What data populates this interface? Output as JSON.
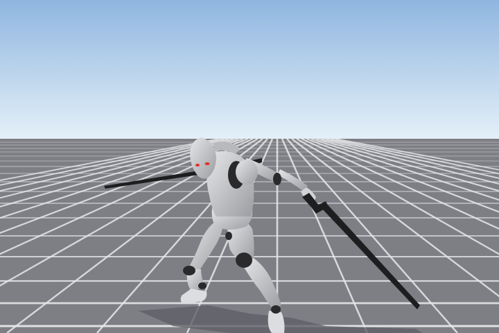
{
  "scene": {
    "sky_top_color": "#8fb6e0",
    "sky_horizon_color": "#e4f0f8",
    "ground_color": "#7d7f85",
    "grid_line_color": "#e8e8ea",
    "character_body_color": "#c9cacc",
    "character_joint_color": "#2a2a2c",
    "character_eye_color": "#e0302a",
    "weapon_color": "#1e1e20"
  }
}
